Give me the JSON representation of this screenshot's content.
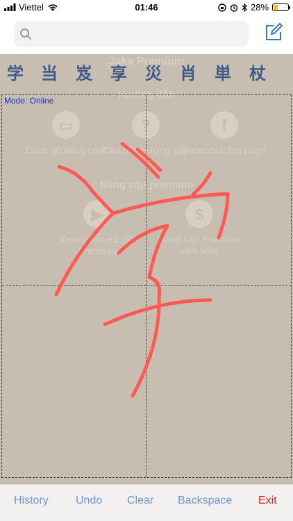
{
  "status_bar": {
    "carrier": "Viettel",
    "time": "01:46",
    "battery": "28%",
    "battery_fraction": 0.28
  },
  "search": {
    "placeholder": ""
  },
  "background": {
    "title": "Jaka Premium",
    "section_guide": "Hướng dẫn",
    "guide_items": [
      "Cách gõ tiếng nhật",
      "Câu hỏi thường gặp",
      "Facebook fan page"
    ],
    "section_upgrade": "Nâng cấp premium",
    "upgrade_items": [
      "Xem video +1 giờ Premium",
      "Nâng cấp Premium vĩnh viễn"
    ]
  },
  "candidates": [
    "学",
    "当",
    "岌",
    "享",
    "災",
    "肖",
    "単",
    "杖"
  ],
  "mode_label": "Mode: Online",
  "bottom_bar": {
    "history": "History",
    "undo": "Undo",
    "clear": "Clear",
    "backspace": "Backspace",
    "exit": "Exit"
  },
  "colors": {
    "stroke": "#ff5a55",
    "candidate": "#3f5a89",
    "accent": "#6b97d8",
    "exit": "#e02424",
    "mode": "#1a2fd6"
  },
  "icons": {
    "search": "search-icon",
    "compose": "compose-icon"
  }
}
